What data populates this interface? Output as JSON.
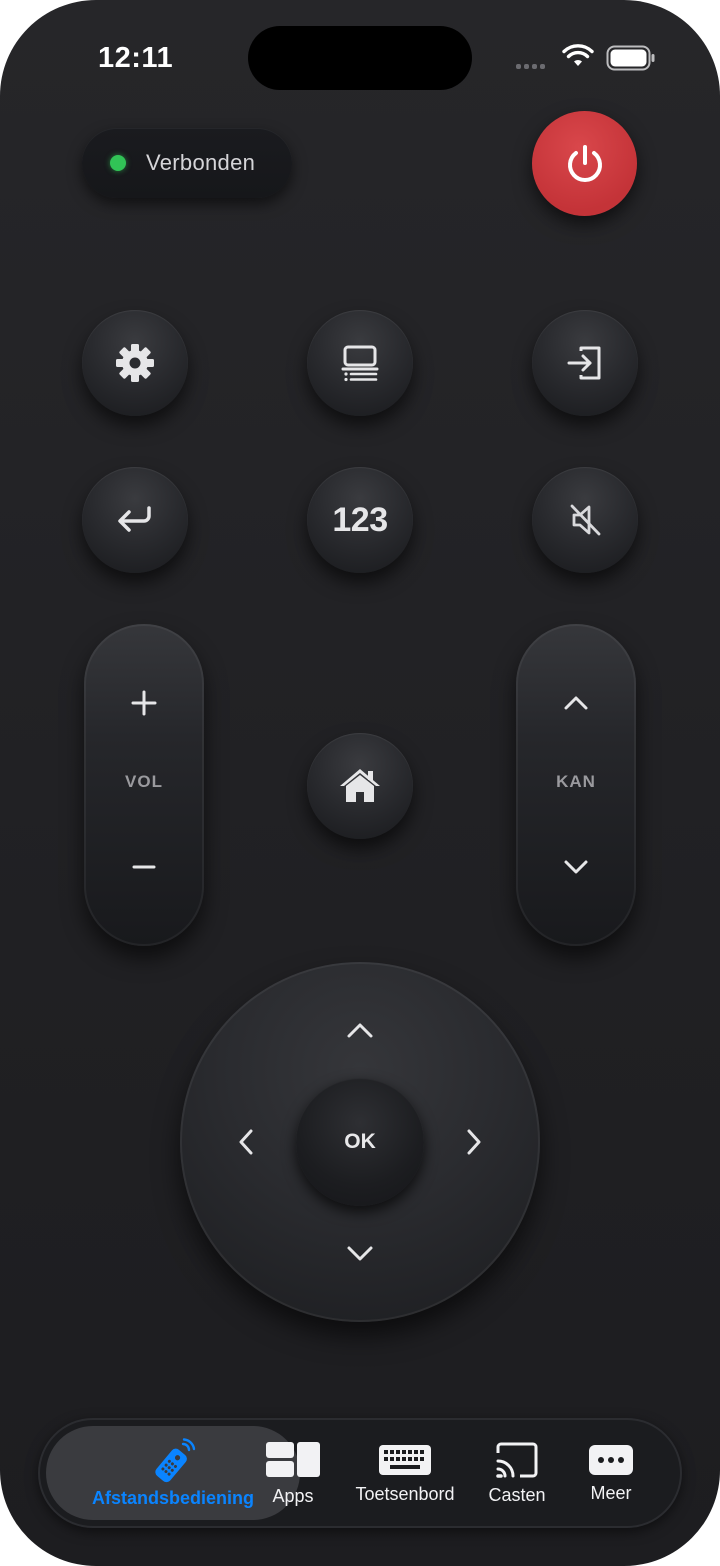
{
  "status_bar": {
    "time": "12:11"
  },
  "connection": {
    "status": "Verbonden",
    "color": "#31c356"
  },
  "power": {
    "icon": "power-icon",
    "color": "#c9383c"
  },
  "buttons": {
    "settings": "gear-icon",
    "guide": "tv-guide-icon",
    "input": "input-source-icon",
    "back": "return-icon",
    "numbers": "123",
    "mute": "mute-icon",
    "home": "home-icon"
  },
  "volume": {
    "label": "VOL",
    "up": "+",
    "down": "−"
  },
  "channel": {
    "label": "KAN"
  },
  "dpad": {
    "ok": "OK"
  },
  "tabs": [
    {
      "label": "Afstandsbediening",
      "icon": "remote-icon",
      "active": true
    },
    {
      "label": "Apps",
      "icon": "apps-icon",
      "active": false
    },
    {
      "label": "Toetsenbord",
      "icon": "keyboard-icon",
      "active": false
    },
    {
      "label": "Casten",
      "icon": "cast-icon",
      "active": false
    },
    {
      "label": "Meer",
      "icon": "more-icon",
      "active": false
    }
  ],
  "colors": {
    "accent": "#0a84ff",
    "background": "#222225"
  }
}
